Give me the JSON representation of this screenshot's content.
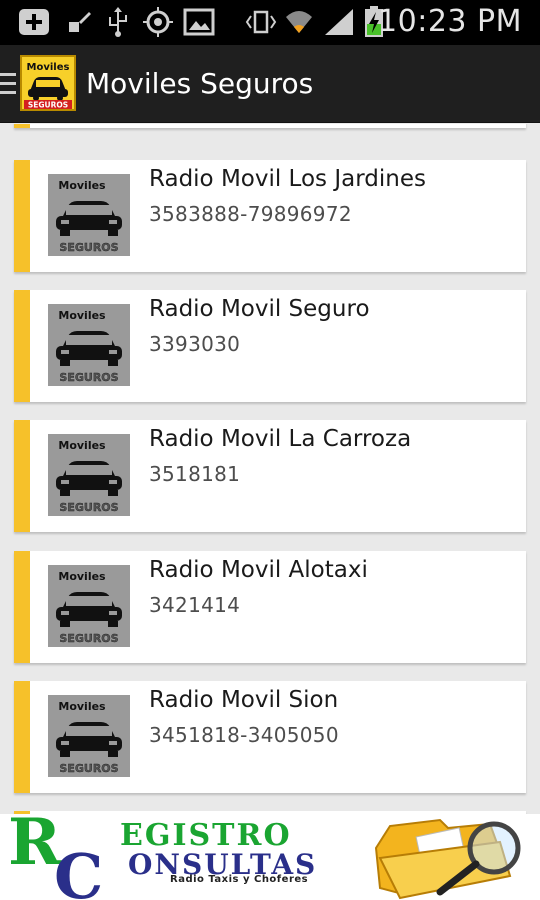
{
  "status_bar": {
    "time": "10:23 PM",
    "icons": [
      "add-box-icon",
      "paint-icon",
      "usb-icon",
      "gps-icon",
      "image-icon",
      "vibrate-icon",
      "wifi-icon",
      "signal-icon",
      "battery-charging-icon"
    ]
  },
  "action_bar": {
    "title": "Moviles Seguros",
    "logo_text_top": "Moviles",
    "logo_text_bottom": "SEGUROS"
  },
  "list": {
    "items": [
      {
        "name": "Radio Movil Los Jardines",
        "phone": "3583888-79896972",
        "thumb_top": "Moviles",
        "thumb_bottom": "SEGUROS"
      },
      {
        "name": "Radio Movil Seguro",
        "phone": "3393030",
        "thumb_top": "Moviles",
        "thumb_bottom": "SEGUROS"
      },
      {
        "name": "Radio Movil La Carroza",
        "phone": "3518181",
        "thumb_top": "Moviles",
        "thumb_bottom": "SEGUROS"
      },
      {
        "name": "Radio Movil Alotaxi",
        "phone": "3421414",
        "thumb_top": "Moviles",
        "thumb_bottom": "SEGUROS"
      },
      {
        "name": "Radio Movil Sion",
        "phone": "3451818-3405050",
        "thumb_top": "Moviles",
        "thumb_bottom": "SEGUROS"
      }
    ]
  },
  "banner": {
    "word1": "EGISTRO",
    "word2": "ONSULTAS",
    "tagline": "Radio Taxis y Choferes"
  },
  "colors": {
    "accent": "#f6c12a",
    "action_bar": "#1f1f1f",
    "status_bar": "#000000",
    "list_bg": "#e9e9e9"
  }
}
